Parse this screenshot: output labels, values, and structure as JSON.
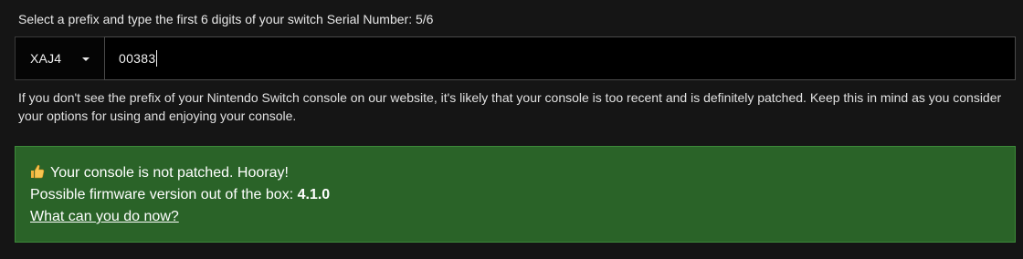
{
  "prompt": {
    "text": "Select a prefix and type the first 6 digits of your switch Serial Number: 5/6"
  },
  "prefix_select": {
    "selected": "XAJ4"
  },
  "serial_input": {
    "value": "00383"
  },
  "info": {
    "text": "If you don't see the prefix of your Nintendo Switch console on our website, it's likely that your console is too recent and is definitely patched. Keep this in mind as you consider your options for using and enjoying your console."
  },
  "result": {
    "status_text": "Your console is not patched. Hooray!",
    "firmware_label": "Possible firmware version out of the box: ",
    "firmware_version": "4.1.0",
    "link_text": "What can you do now?",
    "icon": "thumbs-up-icon",
    "background_color": "#2a6328"
  }
}
